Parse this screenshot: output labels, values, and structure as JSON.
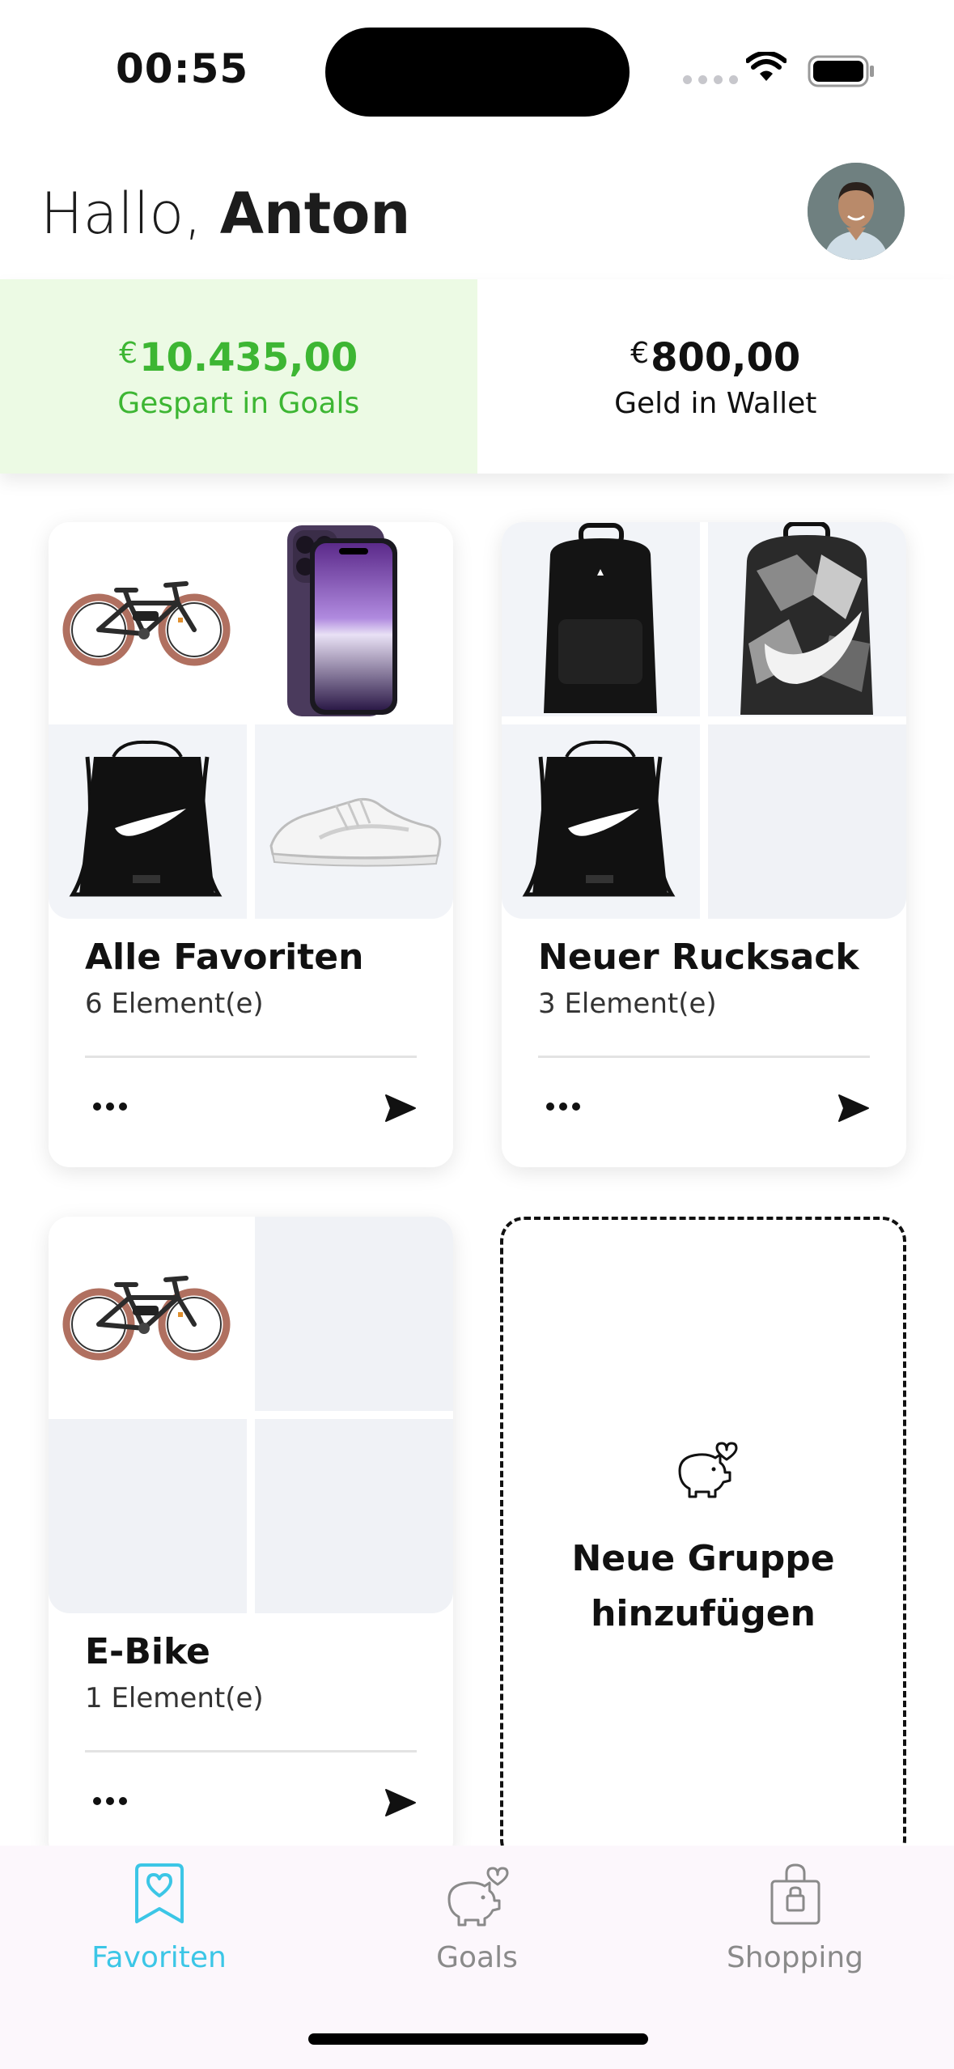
{
  "status_bar": {
    "time": "00:55"
  },
  "header": {
    "greeting_prefix": "Hallo, ",
    "user_name": "Anton"
  },
  "balances": {
    "goals": {
      "currency": "€",
      "amount": "10.435,00",
      "label": "Gespart in Goals",
      "color": "#3db633",
      "background": "#ecfae4"
    },
    "wallet": {
      "currency": "€",
      "amount": "800,00",
      "label": "Geld in Wallet"
    }
  },
  "groups": [
    {
      "title": "Alle Favoriten",
      "count": "6 Element(e)",
      "images": [
        "e-bike",
        "iphone",
        "gym-bag",
        "sneaker"
      ]
    },
    {
      "title": "Neuer Rucksack",
      "count": "3 Element(e)",
      "images": [
        "black-backpack",
        "camo-backpack",
        "gym-bag",
        "empty"
      ]
    },
    {
      "title": "E-Bike",
      "count": "1 Element(e)",
      "images": [
        "e-bike",
        "empty",
        "empty",
        "empty"
      ]
    }
  ],
  "add_group": {
    "line1": "Neue Gruppe",
    "line2": "hinzufügen",
    "icon": "piggy-bank-heart-icon"
  },
  "tabs": [
    {
      "label": "Favoriten",
      "icon": "favorites-heart-icon",
      "active": true
    },
    {
      "label": "Goals",
      "icon": "piggy-bank-heart-icon",
      "active": false
    },
    {
      "label": "Shopping",
      "icon": "shopping-bag-icon",
      "active": false
    }
  ],
  "colors": {
    "accent": "#3cc6e6",
    "tab_bar": "#fcf7fc"
  }
}
